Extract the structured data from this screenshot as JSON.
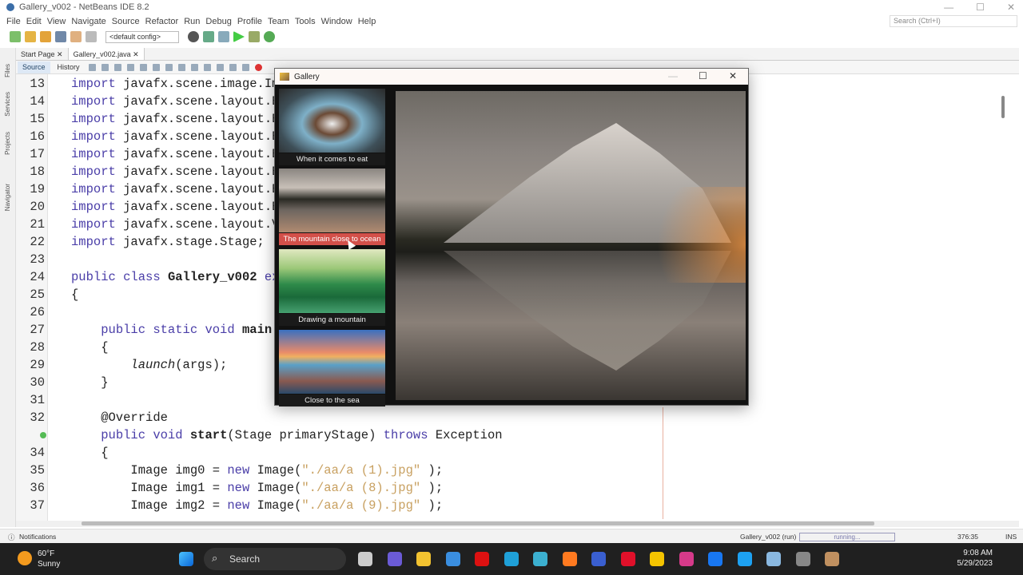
{
  "window": {
    "title": "Gallery_v002 - NetBeans IDE 8.2",
    "minimize": "—",
    "maximize": "☐",
    "close": "✕"
  },
  "menu": [
    "File",
    "Edit",
    "View",
    "Navigate",
    "Source",
    "Refactor",
    "Run",
    "Debug",
    "Profile",
    "Team",
    "Tools",
    "Window",
    "Help"
  ],
  "search": {
    "placeholder": "Search (Ctrl+I)"
  },
  "toolbar": {
    "config": "<default config>"
  },
  "side_tabs": [
    "Files",
    "Services",
    "Projects",
    "Navigator"
  ],
  "tabs": [
    {
      "label": "Start Page"
    },
    {
      "label": "Gallery_v002.java"
    }
  ],
  "editor_tabs": {
    "source": "Source",
    "history": "History"
  },
  "code": [
    {
      "n": "13",
      "t": [
        [
          "kw",
          "import"
        ],
        [
          "",
          "javafx.scene.image.Im"
        ]
      ]
    },
    {
      "n": "14",
      "t": [
        [
          "kw",
          "import"
        ],
        [
          "",
          "javafx.scene.layout.B"
        ]
      ]
    },
    {
      "n": "15",
      "t": [
        [
          "kw",
          "import"
        ],
        [
          "",
          "javafx.scene.layout.B"
        ]
      ]
    },
    {
      "n": "16",
      "t": [
        [
          "kw",
          "import"
        ],
        [
          "",
          "javafx.scene.layout.B"
        ]
      ]
    },
    {
      "n": "17",
      "t": [
        [
          "kw",
          "import"
        ],
        [
          "",
          "javafx.scene.layout.B"
        ]
      ]
    },
    {
      "n": "18",
      "t": [
        [
          "kw",
          "import"
        ],
        [
          "",
          "javafx.scene.layout.B"
        ]
      ]
    },
    {
      "n": "19",
      "t": [
        [
          "kw",
          "import"
        ],
        [
          "",
          "javafx.scene.layout.B"
        ]
      ]
    },
    {
      "n": "20",
      "t": [
        [
          "kw",
          "import"
        ],
        [
          "",
          "javafx.scene.layout.B"
        ]
      ]
    },
    {
      "n": "21",
      "t": [
        [
          "kw",
          "import"
        ],
        [
          "",
          "javafx.scene.layout.V"
        ]
      ]
    },
    {
      "n": "22",
      "t": [
        [
          "kw",
          "import"
        ],
        [
          "",
          "javafx.stage.Stage;"
        ]
      ]
    },
    {
      "n": "23",
      "t": []
    },
    {
      "n": "24",
      "t": [
        [
          "kw",
          "public class"
        ],
        [
          "b",
          "Gallery_v002"
        ],
        [
          "kw",
          "ex"
        ]
      ]
    },
    {
      "n": "25",
      "t": [
        [
          "",
          "{"
        ]
      ]
    },
    {
      "n": "26",
      "t": []
    },
    {
      "n": "27",
      "t": [
        [
          "",
          "    "
        ],
        [
          "kw",
          "public static void"
        ],
        [
          "b",
          "main"
        ]
      ]
    },
    {
      "n": "28",
      "t": [
        [
          "",
          "    {"
        ]
      ]
    },
    {
      "n": "29",
      "t": [
        [
          "",
          "        "
        ],
        [
          "i",
          "launch"
        ],
        [
          "",
          "(args);"
        ]
      ]
    },
    {
      "n": "30",
      "t": [
        [
          "",
          "    }"
        ]
      ]
    },
    {
      "n": "31",
      "t": []
    },
    {
      "n": "32",
      "t": [
        [
          "",
          "    @Override"
        ]
      ]
    },
    {
      "n": "",
      "t": [
        [
          "",
          "    "
        ],
        [
          "kw",
          "public void"
        ],
        [
          "b",
          "start"
        ],
        [
          "",
          "(Stage primaryStage)"
        ],
        [
          "kw",
          "throws"
        ],
        [
          "",
          "Exception"
        ]
      ]
    },
    {
      "n": "34",
      "t": [
        [
          "",
          "    {"
        ]
      ]
    },
    {
      "n": "35",
      "t": [
        [
          "",
          "        Image img0 = "
        ],
        [
          "kw",
          "new"
        ],
        [
          "",
          "Image("
        ],
        [
          "s",
          "\"./aa/a (1).jpg\""
        ],
        [
          "",
          ");"
        ]
      ]
    },
    {
      "n": "36",
      "t": [
        [
          "",
          "        Image img1 = "
        ],
        [
          "kw",
          "new"
        ],
        [
          "",
          "Image("
        ],
        [
          "s",
          "\"./aa/a (8).jpg\""
        ],
        [
          "",
          ");"
        ]
      ]
    },
    {
      "n": "37",
      "t": [
        [
          "",
          "        Image img2 = "
        ],
        [
          "kw",
          "new"
        ],
        [
          "",
          "Image("
        ],
        [
          "s",
          "\"./aa/a (9).jpg\""
        ],
        [
          "",
          ");"
        ]
      ]
    }
  ],
  "status": {
    "notifications": "Notifications",
    "run": "Gallery_v002 (run)",
    "progress": "running...",
    "position": "376:35",
    "mode": "INS"
  },
  "gallery": {
    "title": "Gallery",
    "thumbnails": [
      {
        "caption": "When it comes to eat",
        "selected": false
      },
      {
        "caption": "The mountain close to ocean",
        "selected": true
      },
      {
        "caption": "Drawing a mountain",
        "selected": false
      },
      {
        "caption": "Close to the sea",
        "selected": false
      }
    ]
  },
  "taskbar": {
    "temp": "60°F",
    "weather": "Sunny",
    "search": "Search",
    "time": "9:08 AM",
    "date": "5/29/2023"
  }
}
